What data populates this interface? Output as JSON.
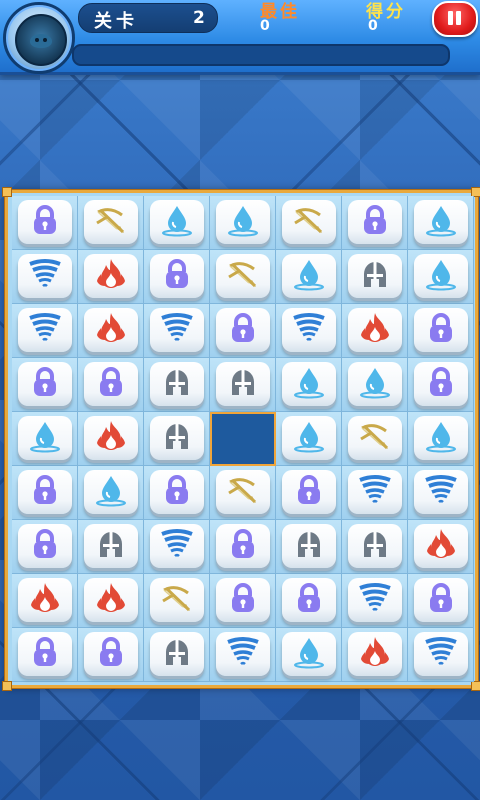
{
  "hud": {
    "level_label": "关卡",
    "level_value": "2",
    "best_label": "最佳",
    "best_value": "0",
    "score_label": "得分",
    "score_value": "0",
    "progress": 0.0
  },
  "icons": {
    "lock": {
      "name": "lock-icon",
      "color": "#8a7bf0"
    },
    "crossbow": {
      "name": "crossbow-icon",
      "color": "#c9a94a"
    },
    "water": {
      "name": "water-drop-icon",
      "color": "#4fb7ea"
    },
    "tornado": {
      "name": "tornado-icon",
      "color": "#2f7fd6"
    },
    "fire": {
      "name": "fire-icon",
      "color": "#e24a36"
    },
    "helmet": {
      "name": "helmet-icon",
      "color": "#6e7a86"
    }
  },
  "board": [
    [
      "lock",
      "crossbow",
      "water",
      "water",
      "crossbow",
      "lock",
      "water"
    ],
    [
      "tornado",
      "fire",
      "lock",
      "crossbow",
      "water",
      "helmet",
      "water"
    ],
    [
      "tornado",
      "fire",
      "tornado",
      "lock",
      "tornado",
      "fire",
      "lock"
    ],
    [
      "lock",
      "lock",
      "helmet",
      "helmet",
      "water",
      "water",
      "lock"
    ],
    [
      "water",
      "fire",
      "helmet",
      "",
      "water",
      "crossbow",
      "water"
    ],
    [
      "lock",
      "water",
      "lock",
      "crossbow",
      "lock",
      "tornado",
      "tornado"
    ],
    [
      "lock",
      "helmet",
      "tornado",
      "lock",
      "helmet",
      "helmet",
      "fire"
    ],
    [
      "fire",
      "fire",
      "crossbow",
      "lock",
      "lock",
      "tornado",
      "lock"
    ],
    [
      "lock",
      "lock",
      "helmet",
      "tornado",
      "water",
      "fire",
      "tornado"
    ]
  ]
}
